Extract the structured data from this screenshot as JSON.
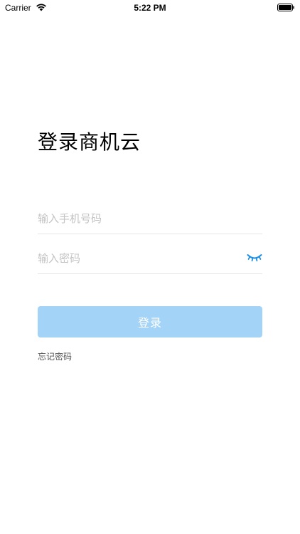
{
  "status_bar": {
    "carrier": "Carrier",
    "time": "5:22 PM",
    "icons": [
      "wifi-icon",
      "battery-icon"
    ]
  },
  "login": {
    "title": "登录商机云",
    "phone_placeholder": "输入手机号码",
    "password_placeholder": "输入密码",
    "password_visibility_icon": "eye-closed-icon",
    "submit_label": "登录",
    "forgot_password_label": "忘记密码"
  },
  "colors": {
    "accent": "#1a8fe6",
    "button_disabled_bg": "#a3d3f7",
    "divider": "#e6e6e6",
    "placeholder": "#c3c3c3"
  }
}
